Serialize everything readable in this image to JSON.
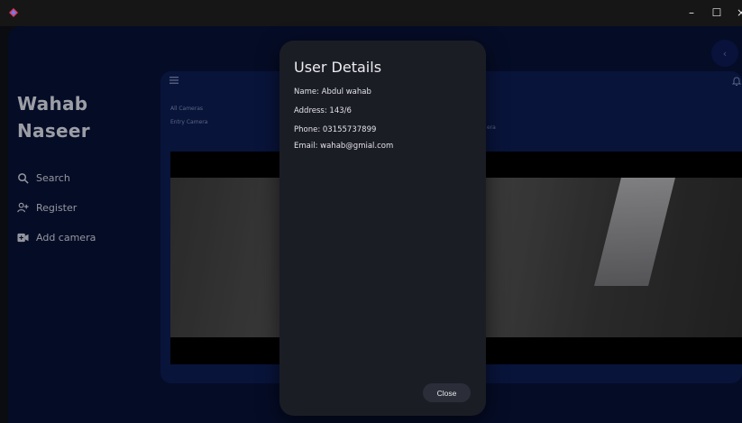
{
  "window": {
    "minimize_glyph": "–",
    "maximize_glyph": "☐",
    "close_glyph": "×"
  },
  "sidebar": {
    "user_first_name": "Wahab",
    "user_last_name": "Naseer",
    "items": [
      {
        "label": "Search",
        "icon": "search-icon"
      },
      {
        "label": "Register",
        "icon": "add-person-icon"
      },
      {
        "label": "Add camera",
        "icon": "video-camera-icon"
      }
    ]
  },
  "topbar": {
    "fab_glyph": "‹"
  },
  "panel": {
    "camera_labels": [
      "All Cameras",
      "Entry Camera"
    ],
    "right_label": "era"
  },
  "dialog": {
    "title": "User Details",
    "details": [
      "Name: Abdul wahab",
      "Address: 143/6",
      "Phone: 03155737899",
      "Email: wahab@gmial.com"
    ],
    "close_label": "Close"
  },
  "colors": {
    "app_background": "#071135",
    "panel_background": "#0d1c52",
    "dialog_background": "#1b1d25",
    "accent_logo": "#e0385a"
  }
}
